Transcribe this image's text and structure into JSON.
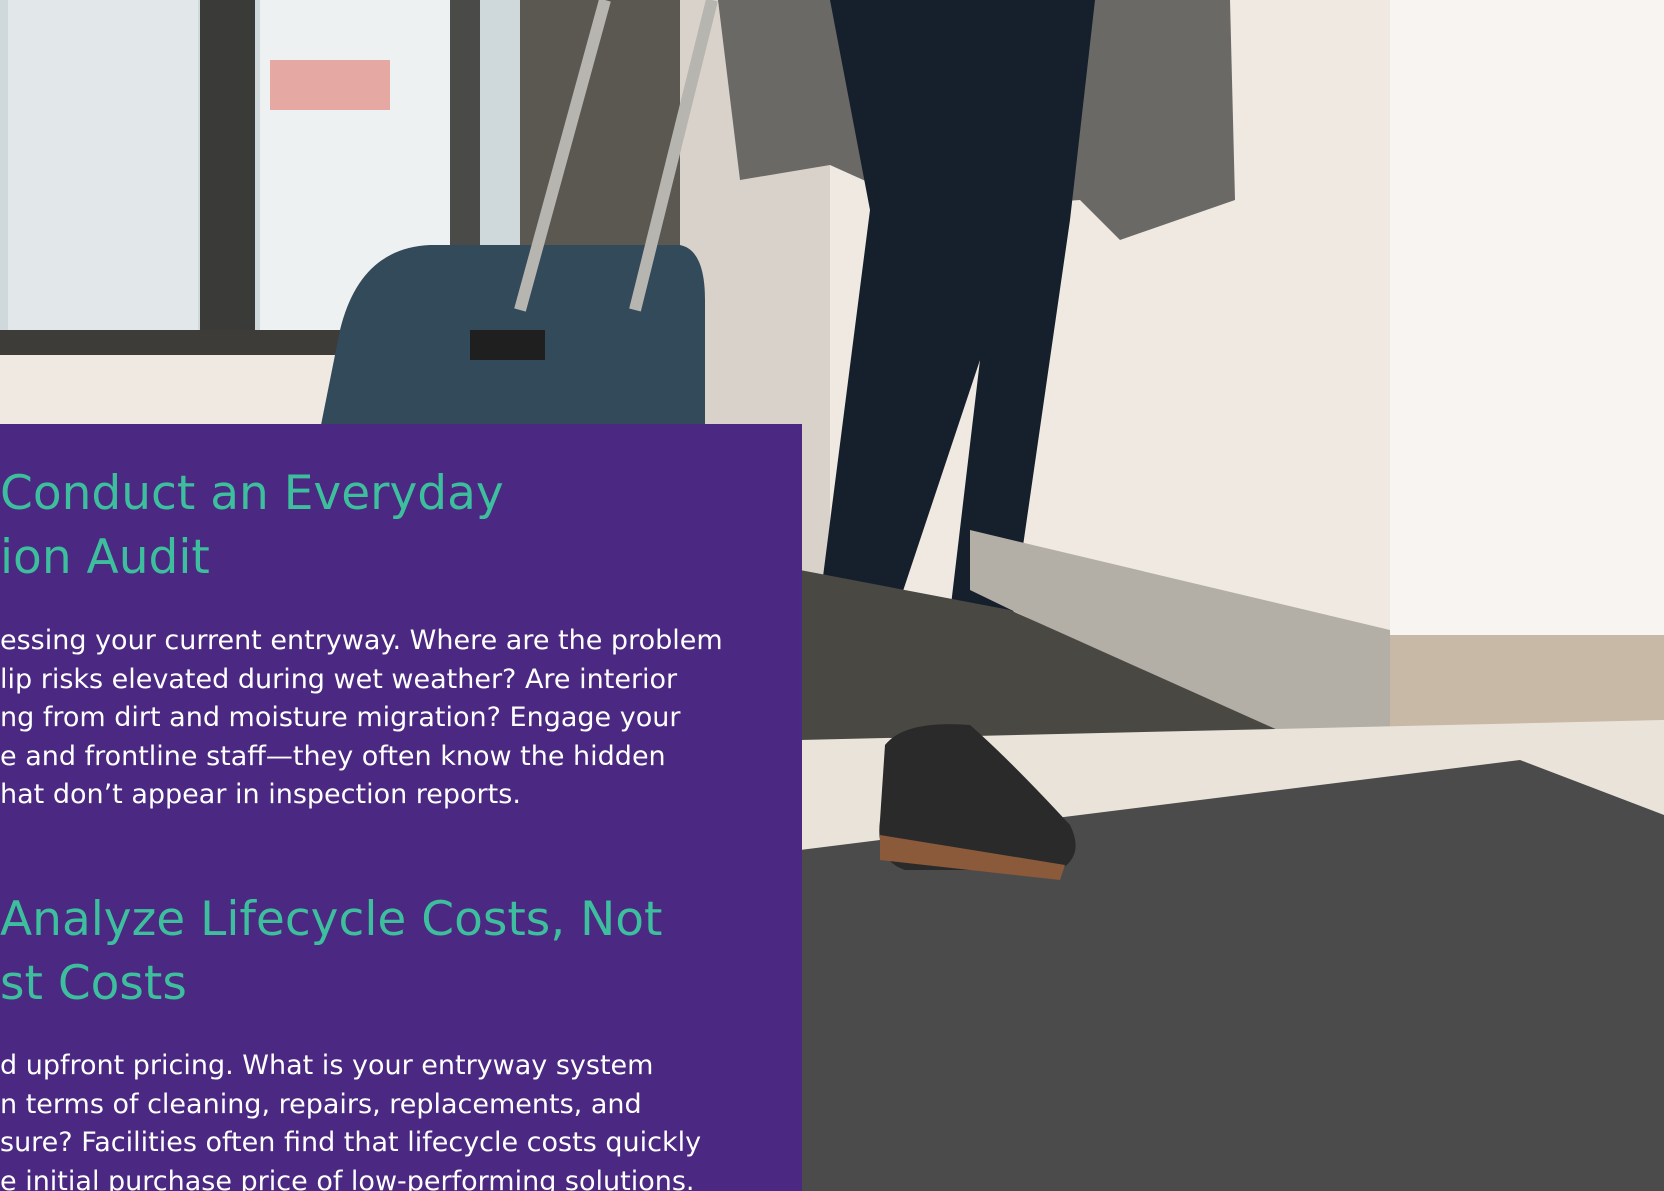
{
  "sections": [
    {
      "heading": [
        "Conduct an Everyday",
        "ion Audit"
      ],
      "body": [
        "essing your current entryway. Where are the problem",
        "lip risks elevated during wet weather? Are interior",
        "ng from dirt and moisture migration? Engage your",
        "e and frontline staff—they often know the hidden",
        "hat don’t appear in inspection reports."
      ]
    },
    {
      "heading": [
        " Analyze Lifecycle Costs, Not",
        "st Costs"
      ],
      "body": [
        "d upfront pricing. What is your entryway system",
        "n terms of cleaning, repairs, replacements, and",
        "sure? Facilities often find that lifecycle costs quickly",
        "e initial purchase price of low-performing solutions."
      ]
    }
  ],
  "colors": {
    "panel": "#4b2882",
    "heading": "#3dbf9e",
    "body": "#ffffff"
  }
}
